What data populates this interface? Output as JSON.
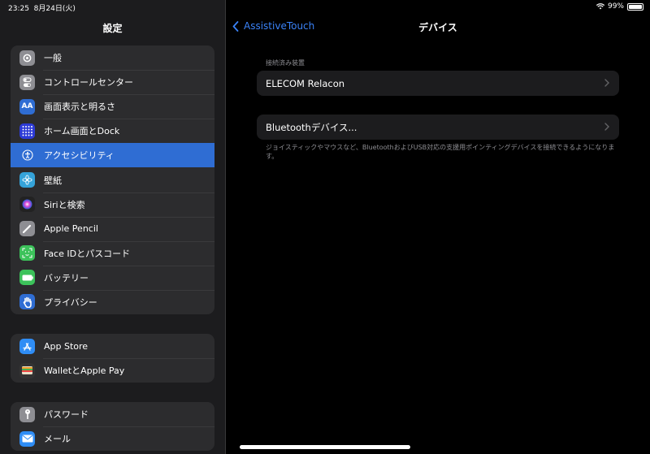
{
  "status_bar": {
    "time": "23:25",
    "date": "8月24日(火)",
    "battery": "99%",
    "battery_level": 0.99,
    "wifi_icon": "wifi-icon"
  },
  "sidebar": {
    "title": "設定",
    "groups": [
      [
        {
          "label": "一般",
          "icon": "gear-icon",
          "color": "#8e8e93"
        },
        {
          "label": "コントロールセンター",
          "icon": "toggles-icon",
          "color": "#8e8e93"
        },
        {
          "label": "画面表示と明るさ",
          "icon": "text-size-icon",
          "color": "#2f6dd3"
        },
        {
          "label": "ホーム画面とDock",
          "icon": "home-grid-icon",
          "color": "#2d3bd6"
        },
        {
          "label": "アクセシビリティ",
          "icon": "accessibility-icon",
          "color": "#2f6dd3",
          "selected": true
        },
        {
          "label": "壁紙",
          "icon": "flower-icon",
          "color": "#35a3d9"
        },
        {
          "label": "Siriと検索",
          "icon": "siri-icon",
          "color": "#222"
        },
        {
          "label": "Apple Pencil",
          "icon": "pencil-icon",
          "color": "#8e8e93"
        },
        {
          "label": "Face IDとパスコード",
          "icon": "face-id-icon",
          "color": "#3cc25a"
        },
        {
          "label": "バッテリー",
          "icon": "battery-icon",
          "color": "#3cc25a"
        },
        {
          "label": "プライバシー",
          "icon": "hand-icon",
          "color": "#2f6dd3"
        }
      ],
      [
        {
          "label": "App Store",
          "icon": "app-store-icon",
          "color": "#2f8df5"
        },
        {
          "label": "WalletとApple Pay",
          "icon": "wallet-icon",
          "color": "#333"
        }
      ],
      [
        {
          "label": "パスワード",
          "icon": "key-icon",
          "color": "#8e8e93"
        },
        {
          "label": "メール",
          "icon": "mail-icon",
          "color": "#2f8df5"
        }
      ]
    ]
  },
  "main": {
    "back_label": "AssistiveTouch",
    "title": "デバイス",
    "connected_header": "接続済み装置",
    "connected_device": "ELECOM Relacon",
    "bluetooth_label": "Bluetoothデバイス...",
    "footer": "ジョイスティックやマウスなど、BluetoothおよびUSB対応の支援用ポインティングデバイスを接続できるようになります。"
  },
  "colors": {
    "accent": "#3a82f7",
    "selected_row": "#2f6dd3"
  }
}
